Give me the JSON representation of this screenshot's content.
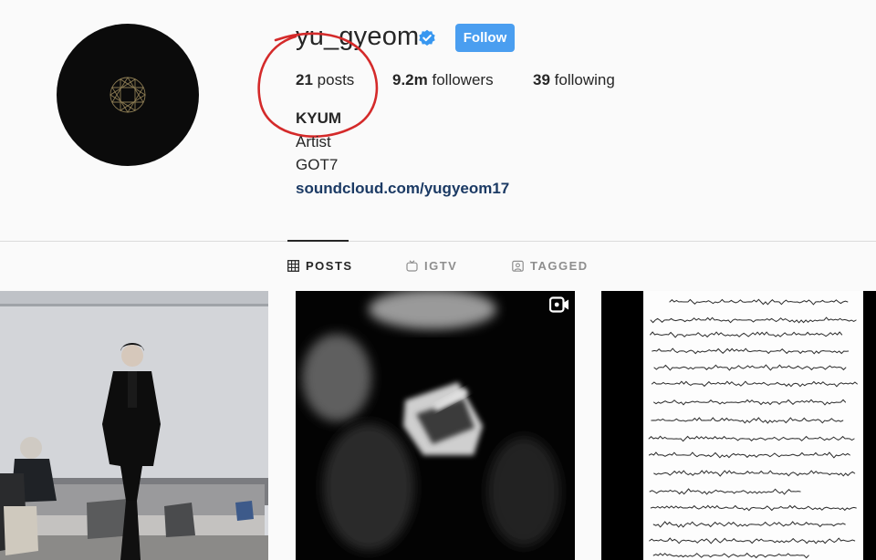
{
  "profile": {
    "username": "yu_gyeom",
    "follow_label": "Follow",
    "stats": {
      "posts_count": "21",
      "posts_label": "posts",
      "followers_count": "9.2m",
      "followers_label": "followers",
      "following_count": "39",
      "following_label": "following"
    },
    "bio": {
      "name": "KYUM",
      "category": "Artist",
      "line": "GOT7",
      "link": "soundcloud.com/yugyeom17"
    }
  },
  "tabs": [
    {
      "label": "POSTS",
      "icon": "grid-icon",
      "active": true
    },
    {
      "label": "IGTV",
      "icon": "igtv-icon",
      "active": false
    },
    {
      "label": "TAGGED",
      "icon": "tagged-icon",
      "active": false
    }
  ],
  "posts": [
    {
      "type": "photo",
      "description_icon": "photo"
    },
    {
      "type": "video",
      "icon": "video-camera-icon"
    },
    {
      "type": "photo",
      "description_icon": "handwritten-letter"
    }
  ],
  "colors": {
    "follow_button": "#4a9ef0",
    "verified_badge": "#3897f0",
    "link": "#1b3a64",
    "annotation_circle": "#d42a2a"
  }
}
